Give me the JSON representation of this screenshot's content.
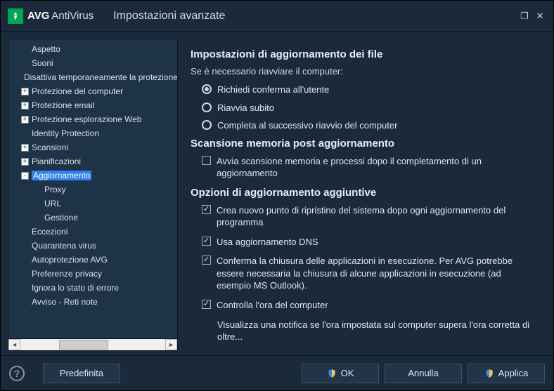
{
  "brand": {
    "logo_text": "AVG",
    "product": "AntiVirus"
  },
  "window": {
    "title": "Impostazioni avanzate"
  },
  "tree": [
    {
      "label": "Aspetto",
      "depth": 1,
      "expander": null
    },
    {
      "label": "Suoni",
      "depth": 1,
      "expander": null
    },
    {
      "label": "Disattiva temporaneamente la protezione AVG",
      "depth": 1,
      "expander": null
    },
    {
      "label": "Protezione del computer",
      "depth": 1,
      "expander": "+"
    },
    {
      "label": "Protezione email",
      "depth": 1,
      "expander": "+"
    },
    {
      "label": "Protezione esplorazione Web",
      "depth": 1,
      "expander": "+"
    },
    {
      "label": "Identity Protection",
      "depth": 1,
      "expander": null
    },
    {
      "label": "Scansioni",
      "depth": 1,
      "expander": "+"
    },
    {
      "label": "Pianificazioni",
      "depth": 1,
      "expander": "+"
    },
    {
      "label": "Aggiornamento",
      "depth": 1,
      "expander": "-",
      "selected": true
    },
    {
      "label": "Proxy",
      "depth": 2,
      "expander": null
    },
    {
      "label": "URL",
      "depth": 2,
      "expander": null
    },
    {
      "label": "Gestione",
      "depth": 2,
      "expander": null
    },
    {
      "label": "Eccezioni",
      "depth": 1,
      "expander": null
    },
    {
      "label": "Quarantena virus",
      "depth": 1,
      "expander": null
    },
    {
      "label": "Autoprotezione AVG",
      "depth": 1,
      "expander": null
    },
    {
      "label": "Preferenze privacy",
      "depth": 1,
      "expander": null
    },
    {
      "label": "Ignora lo stato di errore",
      "depth": 1,
      "expander": null
    },
    {
      "label": "Avviso - Reti note",
      "depth": 1,
      "expander": null
    }
  ],
  "panel": {
    "section1_title": "Impostazioni di aggiornamento dei file",
    "restart_prompt": "Se è necessario riavviare il computer:",
    "restart_options": [
      {
        "label": "Richiedi conferma all'utente",
        "checked": true
      },
      {
        "label": "Riavvia subito",
        "checked": false
      },
      {
        "label": "Completa al successivo riavvio del computer",
        "checked": false
      }
    ],
    "section2_title": "Scansione memoria post aggiornamento",
    "memscan": {
      "label": "Avvia scansione memoria e processi dopo il completamento di un aggiornamento",
      "checked": false
    },
    "section3_title": "Opzioni di aggiornamento aggiuntive",
    "extra": [
      {
        "label": "Crea nuovo punto di ripristino del sistema dopo ogni aggiornamento del programma",
        "checked": true
      },
      {
        "label": "Usa aggiornamento DNS",
        "checked": true
      },
      {
        "label": "Conferma la chiusura delle applicazioni in esecuzione. Per AVG potrebbe essere necessaria la chiusura di alcune applicazioni in esecuzione (ad esempio MS Outlook).",
        "checked": true
      },
      {
        "label": "Controlla l'ora del computer",
        "checked": true
      }
    ],
    "clock_note": "Visualizza una notifica se l'ora impostata sul computer supera l'ora corretta di oltre..."
  },
  "footer": {
    "help": "?",
    "default_btn": "Predefinita",
    "ok_btn": "OK",
    "cancel_btn": "Annulla",
    "apply_btn": "Applica"
  }
}
